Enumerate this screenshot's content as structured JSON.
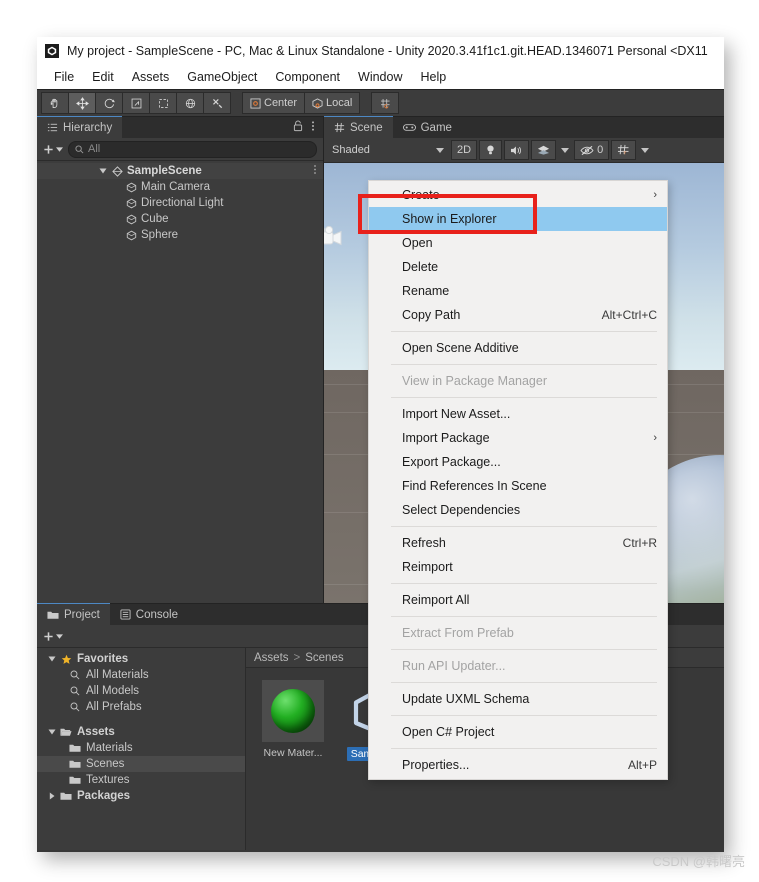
{
  "window": {
    "title": "My project - SampleScene - PC, Mac & Linux Standalone - Unity 2020.3.41f1c1.git.HEAD.1346071 Personal <DX11",
    "app_icon": "unity-icon"
  },
  "menubar": {
    "items": [
      {
        "label": "File"
      },
      {
        "label": "Edit"
      },
      {
        "label": "Assets"
      },
      {
        "label": "GameObject"
      },
      {
        "label": "Component"
      },
      {
        "label": "Window"
      },
      {
        "label": "Help"
      }
    ]
  },
  "toolbar": {
    "tools": [
      {
        "name": "hand-tool-icon"
      },
      {
        "name": "move-tool-icon"
      },
      {
        "name": "rotate-tool-icon"
      },
      {
        "name": "scale-tool-icon"
      },
      {
        "name": "rect-tool-icon"
      },
      {
        "name": "transform-tool-icon"
      },
      {
        "name": "custom-tool-icon"
      }
    ],
    "pivot_label": "Center",
    "handle_label": "Local",
    "grid_snap": "grid-snap-icon"
  },
  "hierarchy": {
    "tab_label": "Hierarchy",
    "tab_icon": "hierarchy-icon",
    "lock_icon": "lock-icon",
    "menu_icon": "kebab-icon",
    "add_label": "+",
    "search_placeholder": "All",
    "search_value": "",
    "tree": [
      {
        "label": "SampleScene",
        "icon": "scene-icon",
        "depth": 0,
        "expanded": true,
        "selected": false
      },
      {
        "label": "Main Camera",
        "icon": "gameobject-icon",
        "depth": 1
      },
      {
        "label": "Directional Light",
        "icon": "gameobject-icon",
        "depth": 1
      },
      {
        "label": "Cube",
        "icon": "gameobject-icon",
        "depth": 1
      },
      {
        "label": "Sphere",
        "icon": "gameobject-icon",
        "depth": 1
      }
    ]
  },
  "scene_panel": {
    "tabs": [
      {
        "label": "Scene",
        "icon": "scene-grid-icon",
        "selected": true
      },
      {
        "label": "Game",
        "icon": "game-controller-icon",
        "selected": false
      }
    ],
    "draw_mode": "Shaded",
    "mode_2d": "2D",
    "lighting_icon": "light-bulb-icon",
    "audio_icon": "audio-icon",
    "effects_icon": "effects-icon",
    "hidden_count": "0",
    "hidden_icon": "hidden-eye-icon",
    "grid_icon": "grid-visibility-icon"
  },
  "project_panel": {
    "tabs": [
      {
        "label": "Project",
        "icon": "folder-icon",
        "selected": true
      },
      {
        "label": "Console",
        "icon": "console-icon",
        "selected": false
      }
    ],
    "add_label": "+",
    "tree": [
      {
        "label": "Favorites",
        "icon": "star-icon",
        "depth": 0,
        "expanded": true,
        "bold": true
      },
      {
        "label": "All Materials",
        "icon": "search-icon",
        "depth": 1
      },
      {
        "label": "All Models",
        "icon": "search-icon",
        "depth": 1
      },
      {
        "label": "All Prefabs",
        "icon": "search-icon",
        "depth": 1
      },
      {
        "label": "Assets",
        "icon": "open-folder-icon",
        "depth": 0,
        "expanded": true,
        "bold": true
      },
      {
        "label": "Materials",
        "icon": "folder-icon",
        "depth": 1
      },
      {
        "label": "Scenes",
        "icon": "folder-icon",
        "depth": 1,
        "selected": true
      },
      {
        "label": "Textures",
        "icon": "folder-icon",
        "depth": 1
      },
      {
        "label": "Packages",
        "icon": "folder-icon",
        "depth": 0,
        "expanded": false,
        "bold": true
      }
    ],
    "breadcrumb": [
      "Assets",
      "Scenes"
    ],
    "breadcrumb_separator": ">",
    "assets": [
      {
        "label": "New Mater...",
        "kind": "material",
        "selected": false
      },
      {
        "label": "SampleSc...",
        "kind": "scene",
        "selected": true
      }
    ]
  },
  "context_menu": {
    "items": [
      {
        "label": "Create",
        "submenu": true
      },
      {
        "label": "Show in Explorer",
        "highlighted": true
      },
      {
        "label": "Open"
      },
      {
        "label": "Delete"
      },
      {
        "label": "Rename"
      },
      {
        "label": "Copy Path",
        "shortcut": "Alt+Ctrl+C"
      },
      {
        "separator": true
      },
      {
        "label": "Open Scene Additive"
      },
      {
        "separator": true
      },
      {
        "label": "View in Package Manager",
        "disabled": true
      },
      {
        "separator": true
      },
      {
        "label": "Import New Asset..."
      },
      {
        "label": "Import Package",
        "submenu": true
      },
      {
        "label": "Export Package..."
      },
      {
        "label": "Find References In Scene"
      },
      {
        "label": "Select Dependencies"
      },
      {
        "separator": true
      },
      {
        "label": "Refresh",
        "shortcut": "Ctrl+R"
      },
      {
        "label": "Reimport"
      },
      {
        "separator": true
      },
      {
        "label": "Reimport All"
      },
      {
        "separator": true
      },
      {
        "label": "Extract From Prefab",
        "disabled": true
      },
      {
        "separator": true
      },
      {
        "label": "Run API Updater...",
        "disabled": true
      },
      {
        "separator": true
      },
      {
        "label": "Update UXML Schema"
      },
      {
        "separator": true
      },
      {
        "label": "Open C# Project"
      },
      {
        "separator": true
      },
      {
        "label": "Properties...",
        "shortcut": "Alt+P"
      }
    ]
  },
  "annotation": {
    "highlight_color": "#e8211b",
    "target_label": "Show in Explorer"
  },
  "watermark": {
    "text": "CSDN @韩曙亮"
  }
}
